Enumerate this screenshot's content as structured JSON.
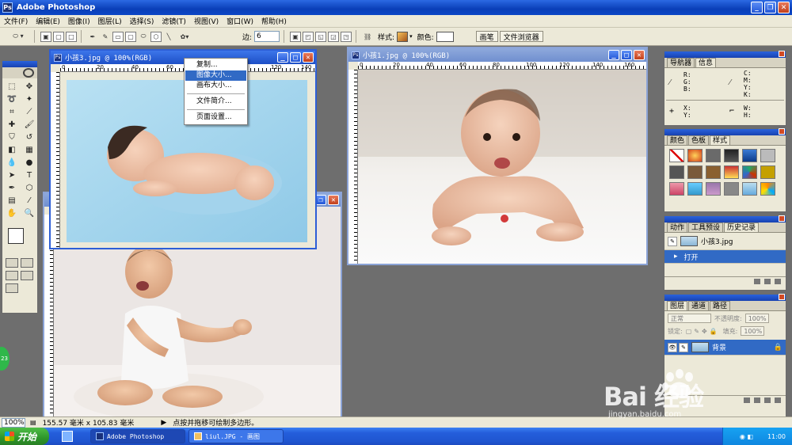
{
  "app": {
    "title": "Adobe Photoshop"
  },
  "menu": [
    "文件(F)",
    "编辑(E)",
    "图像(I)",
    "图层(L)",
    "选择(S)",
    "滤镜(T)",
    "视图(V)",
    "窗口(W)",
    "帮助(H)"
  ],
  "options": {
    "edge_label": "边:",
    "edge_value": "6",
    "style_label": "样式:",
    "color_label": "颜色:",
    "well_tabs": [
      "画笔",
      "文件浏览器"
    ]
  },
  "documents": [
    {
      "title": "小孩3.jpg @ 100%(RGB)",
      "ruler_ticks": [
        "0",
        "20",
        "40",
        "60",
        "80",
        "100",
        "120",
        "140"
      ]
    },
    {
      "title": "小孩1.jpg @ 100%(RGB)",
      "ruler_ticks": [
        "0",
        "20",
        "40",
        "60",
        "80",
        "100",
        "120",
        "140",
        "160"
      ]
    }
  ],
  "context_menu": {
    "items": [
      "复制...",
      "图像大小...",
      "画布大小...",
      "文件简介...",
      "页面设置..."
    ],
    "highlighted_index": 1
  },
  "palettes": {
    "info": {
      "tabs": [
        "导航器",
        "信息"
      ],
      "active_tab": 1,
      "rgb": "R:\nG:\nB:",
      "cmyk": "C:\nM:\nY:\nK:",
      "xy": "X:\nY:",
      "wh": "W:\nH:"
    },
    "swatches": {
      "tabs": [
        "颜色",
        "色板",
        "样式"
      ],
      "active_tab": 2
    },
    "history": {
      "tabs": [
        "动作",
        "工具预设",
        "历史记录"
      ],
      "active_tab": 2,
      "snapshot": "小孩3.jpg",
      "step": "打开"
    },
    "layers": {
      "tabs": [
        "图层",
        "通道",
        "路径"
      ],
      "active_tab": 0,
      "blend_mode": "正常",
      "opacity_label": "不透明度:",
      "opacity_value": "100%",
      "lock_label": "锁定:",
      "fill_label": "填充:",
      "fill_value": "100%",
      "layer_name": "背景"
    }
  },
  "status": {
    "zoom": "100%",
    "doc_size": "155.57 毫米 x 105.83 毫米",
    "hint": "点按并拖移可绘制多边形。"
  },
  "taskbar": {
    "start": "开始",
    "tasks": [
      "Adobe Photoshop",
      "liul.JPG - 画图"
    ],
    "clock": "11:00"
  },
  "watermark": {
    "logo": "Bai 经验",
    "url": "jingyan.baidu.com"
  }
}
